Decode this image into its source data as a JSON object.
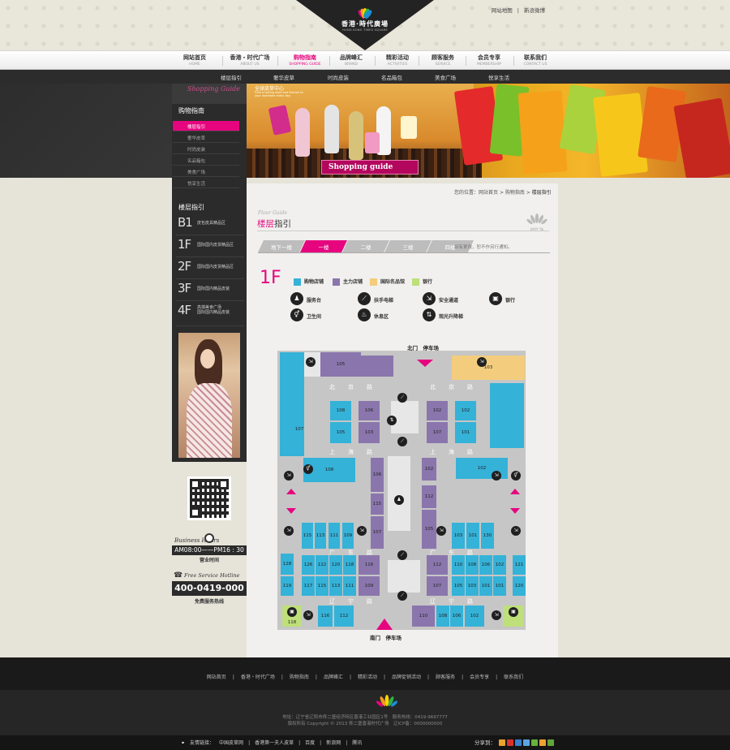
{
  "header": {
    "logo_cn": "香港·時代廣場",
    "logo_en": "HONG KONG TIMES SQUARE",
    "links": [
      "网站地图",
      "|",
      "新浪微博"
    ]
  },
  "nav": [
    {
      "cn": "网站首页",
      "en": "HOME"
    },
    {
      "cn": "香港・时代广场",
      "en": "ABOUT US"
    },
    {
      "cn": "购物指南",
      "en": "SHOPPING GUIDE"
    },
    {
      "cn": "品牌峰汇",
      "en": "BRAND"
    },
    {
      "cn": "精彩活动",
      "en": "ACTIVITIES"
    },
    {
      "cn": "顾客服务",
      "en": "SERVICE"
    },
    {
      "cn": "会员专享",
      "en": "MEMBERSHIP"
    },
    {
      "cn": "联系我们",
      "en": "CONTACT US"
    }
  ],
  "subnav": [
    "楼层指引",
    "奢华皮草",
    "时尚皮装",
    "名品箱包",
    "美食广场",
    "悦享生活"
  ],
  "sidebar": {
    "head_script": "Shopping Guide",
    "title": "购物指南",
    "links": [
      "楼层指引",
      "奢华皮草",
      "时尚皮装",
      "名品箱包",
      "美食广场",
      "悦享生活"
    ],
    "floor_title": "楼层指引",
    "floors": [
      {
        "n": "B1",
        "d": "皮包皮具精品区"
      },
      {
        "n": "1F",
        "d": "国际国内皮货精品区"
      },
      {
        "n": "2F",
        "d": "国际国内皮货精品区"
      },
      {
        "n": "3F",
        "d": "国际国内精品皮装"
      },
      {
        "n": "4F",
        "d": "高端美食广场\n国际国内精品皮装"
      }
    ],
    "hours_label": "Business Hours",
    "hours": "AM08:00——PM16 : 30",
    "hours_sub": "营业时间",
    "hotline_label": "Free Service Hotline",
    "hotline": "400-0419-000",
    "hotline_sub": "免费服务热线"
  },
  "banner": {
    "tag": "Shopping guide",
    "small": "全球皮草中心",
    "small2": "Give a lasting style and fashion to your wardrobe every day"
  },
  "breadcrumb": {
    "prefix": "您的位置：",
    "items": [
      "网站首页",
      "购物指南"
    ],
    "current": "楼层指引"
  },
  "page": {
    "title_en": "Floor Guide",
    "title_a": "楼层",
    "title_b": "指引",
    "logo_text": "时代广场"
  },
  "tabs": [
    "地下一楼",
    "一楼",
    "二楼",
    "三楼",
    "四楼"
  ],
  "active_tab": 1,
  "tab_note": "如有更改，恕不作另行通知。",
  "floor_label": "1F",
  "legend": [
    {
      "label": "购物店铺",
      "color": "#35b2d8"
    },
    {
      "label": "主力店铺",
      "color": "#8a76ad"
    },
    {
      "label": "国际名品馆",
      "color": "#f3cd7d"
    },
    {
      "label": "银行",
      "color": "#bedf7a"
    }
  ],
  "facilities": [
    {
      "label": "服务台",
      "icon": "service-desk-icon"
    },
    {
      "label": "扶手电梯",
      "icon": "escalator-icon"
    },
    {
      "label": "安全通道",
      "icon": "safety-exit-icon"
    },
    {
      "label": "银行",
      "icon": "bank-icon"
    },
    {
      "label": "卫生间",
      "icon": "restroom-icon"
    },
    {
      "label": "休息区",
      "icon": "rest-area-icon"
    },
    {
      "label": "观光升降梯",
      "icon": "elevator-icon"
    }
  ],
  "map": {
    "north_gate": "北门　停车场",
    "south_gate": "南门　停车场",
    "roads": [
      "北京路",
      "北京路",
      "上海路",
      "上海路",
      "广东路",
      "广东路",
      "辽宁路",
      "辽宁路"
    ],
    "units": [
      "105",
      "103",
      "108",
      "106",
      "102",
      "102",
      "107",
      "105",
      "103",
      "107",
      "101",
      "108",
      "106",
      "102",
      "102",
      "112",
      "115",
      "115",
      "113",
      "111",
      "109",
      "107",
      "105",
      "103",
      "101",
      "130",
      "128",
      "126",
      "122",
      "120",
      "118",
      "116",
      "112",
      "110",
      "108",
      "106",
      "102",
      "121",
      "119",
      "117",
      "115",
      "113",
      "111",
      "109",
      "107",
      "105",
      "103",
      "101",
      "101",
      "120",
      "118",
      "116",
      "112",
      "110",
      "108",
      "106",
      "102"
    ]
  },
  "footer": {
    "links": [
      "网站首页",
      "|",
      "香港・时代广场",
      "|",
      "购物指南",
      "|",
      "品牌峰汇",
      "|",
      "精彩活动",
      "|",
      "品牌促销活动",
      "|",
      "顾客服务",
      "|",
      "会员专享",
      "|",
      "联系我们"
    ],
    "address": "地址：辽宁省辽阳市佟二堡经济特区香港工业园区1号　服务热线：0419-9697777",
    "copyright": "版权所有 Copyright © 2013 佟二堡香港时代广场　辽ICP备：0000000000",
    "friend_label": "友情链接：",
    "friends": [
      "中国皮草网",
      "|",
      "香港第一夫人皮草",
      "|",
      "百度",
      "|",
      "新浪网",
      "|",
      "腾讯"
    ],
    "share_label": "分享到："
  },
  "colors": {
    "accent": "#e6057f",
    "dark": "#2b2b2b",
    "shop": "#35b2d8",
    "anchor": "#8a76ad",
    "luxury": "#f3cd7d",
    "bank": "#bedf7a"
  }
}
